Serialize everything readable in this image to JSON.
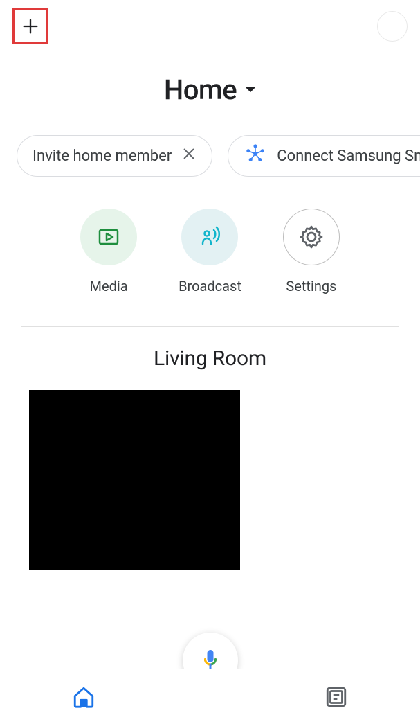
{
  "header": {
    "home_label": "Home"
  },
  "suggestions": [
    {
      "label": "Invite home member",
      "has_close": true,
      "icon": null
    },
    {
      "label": "Connect Samsung Sma",
      "has_close": false,
      "icon": "smartthings"
    }
  ],
  "quick_actions": [
    {
      "label": "Media",
      "type": "media"
    },
    {
      "label": "Broadcast",
      "type": "broadcast"
    },
    {
      "label": "Settings",
      "type": "settings"
    }
  ],
  "room": {
    "title": "Living Room"
  }
}
